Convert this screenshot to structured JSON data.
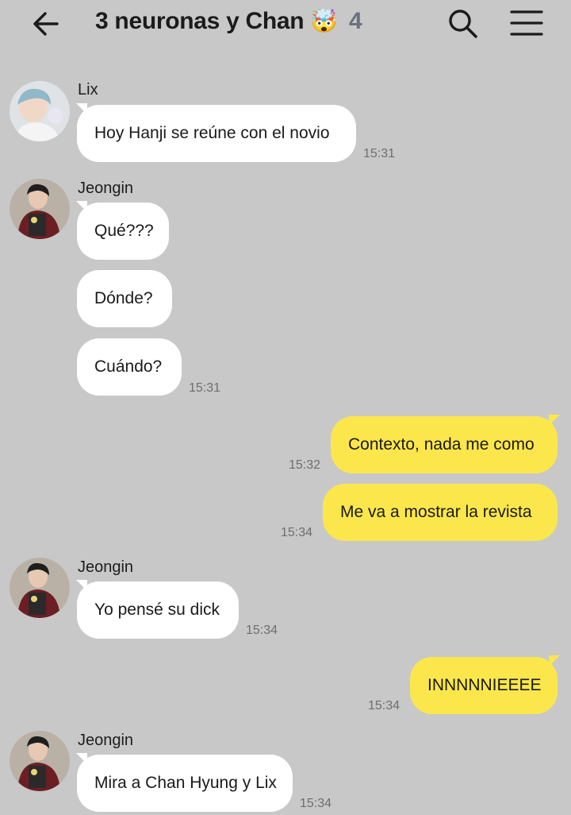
{
  "header": {
    "title": "3 neuronas y Chan",
    "title_emoji": "🤯",
    "member_count": "4",
    "back_icon": "arrow-left-icon",
    "search_icon": "search-icon",
    "menu_icon": "hamburger-menu-icon"
  },
  "colors": {
    "background": "#c8c8c8",
    "incoming_bubble": "#ffffff",
    "outgoing_bubble": "#fbe74c",
    "timestamp": "#6e6e6e"
  },
  "messages": [
    {
      "sender": "Lix",
      "text": "Hoy Hanji se reúne con el novio",
      "time": "15:31",
      "direction": "in"
    },
    {
      "sender": "Jeongin",
      "text": "Qué???",
      "direction": "in"
    },
    {
      "text": "Dónde?",
      "direction": "in"
    },
    {
      "text": "Cuándo?",
      "time": "15:31",
      "direction": "in"
    },
    {
      "text": "Contexto, nada me como",
      "time": "15:32",
      "direction": "out"
    },
    {
      "text": "Me va a mostrar la revista",
      "time": "15:34",
      "direction": "out"
    },
    {
      "sender": "Jeongin",
      "text": "Yo pensé su dick",
      "time": "15:34",
      "direction": "in"
    },
    {
      "text": "INNNNNIEEEE",
      "time": "15:34",
      "direction": "out"
    },
    {
      "sender": "Jeongin",
      "text": "Mira a Chan Hyung y Lix",
      "time": "15:34",
      "direction": "in"
    }
  ]
}
